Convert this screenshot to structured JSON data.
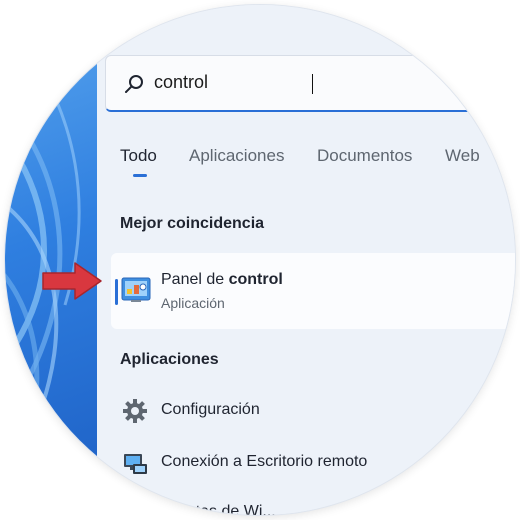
{
  "search": {
    "value": "control"
  },
  "tabs": [
    {
      "label": "Todo",
      "active": true
    },
    {
      "label": "Aplicaciones",
      "active": false
    },
    {
      "label": "Documentos",
      "active": false
    },
    {
      "label": "Web",
      "active": false
    }
  ],
  "best_match": {
    "heading": "Mejor coincidencia",
    "title_prefix": "Panel de ",
    "title_bold": "control",
    "subtitle": "Aplicación",
    "icon": "control-panel-icon"
  },
  "apps": {
    "heading": "Aplicaciones",
    "items": [
      {
        "label": "Configuración",
        "icon": "gear-icon"
      },
      {
        "label": "Conexión a Escritorio remoto",
        "icon": "remote-desktop-icon"
      },
      {
        "label": "...ientas de Wi...",
        "icon": "tools-icon"
      }
    ]
  },
  "colors": {
    "accent": "#2a6fd6",
    "arrow": "#d9373f"
  }
}
